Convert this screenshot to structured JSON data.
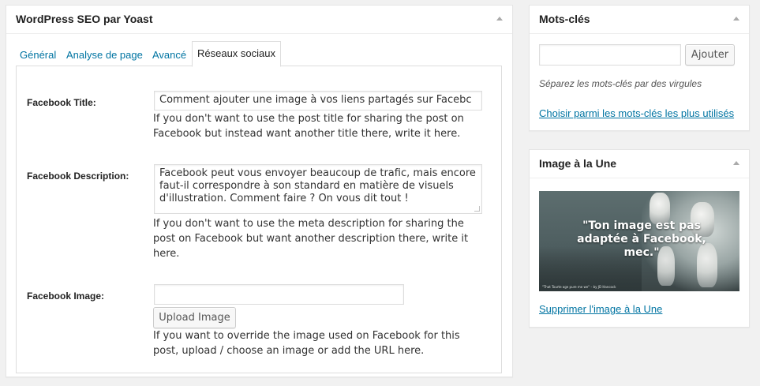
{
  "seo_box": {
    "title": "WordPress SEO par Yoast",
    "tabs": [
      {
        "label": "Général"
      },
      {
        "label": "Analyse de page"
      },
      {
        "label": "Avancé"
      },
      {
        "label": "Réseaux sociaux"
      }
    ],
    "active_tab": "Réseaux sociaux",
    "fields": {
      "facebook_title": {
        "label": "Facebook Title:",
        "value": "Comment ajouter une image à vos liens partagés sur Facebc",
        "help": "If you don't want to use the post title for sharing the post on Facebook but instead want another title there, write it here."
      },
      "facebook_description": {
        "label": "Facebook Description:",
        "value": "Facebook peut vous envoyer beaucoup de trafic, mais encore faut-il correspondre à son standard en matière de visuels d'illustration. Comment faire ? On vous dit tout !",
        "help": "If you don't want to use the meta description for sharing the post on Facebook but want another description there, write it here."
      },
      "facebook_image": {
        "label": "Facebook Image:",
        "value": "",
        "button": "Upload Image",
        "help": "If you want to override the image used on Facebook for this post, upload / choose an image or add the URL here."
      }
    }
  },
  "tags_box": {
    "title": "Mots-clés",
    "input_value": "",
    "add_button": "Ajouter",
    "note": "Séparez les mots-clés par des virgules",
    "choose_link": "Choisir parmi les mots-clés les plus utilisés"
  },
  "featured_box": {
    "title": "Image à la Une",
    "image_caption": "\"Ton image est pas adaptée à Facebook, mec.\"",
    "image_small_text": "\"That Tourte age pure me we\" – by JD Hancock",
    "remove_link": "Supprimer l'image à la Une"
  },
  "colors": {
    "link": "#0074a2",
    "background": "#f1f1f1",
    "box_border": "#e5e5e5"
  },
  "icons": {
    "collapse": "triangle-up-icon"
  }
}
